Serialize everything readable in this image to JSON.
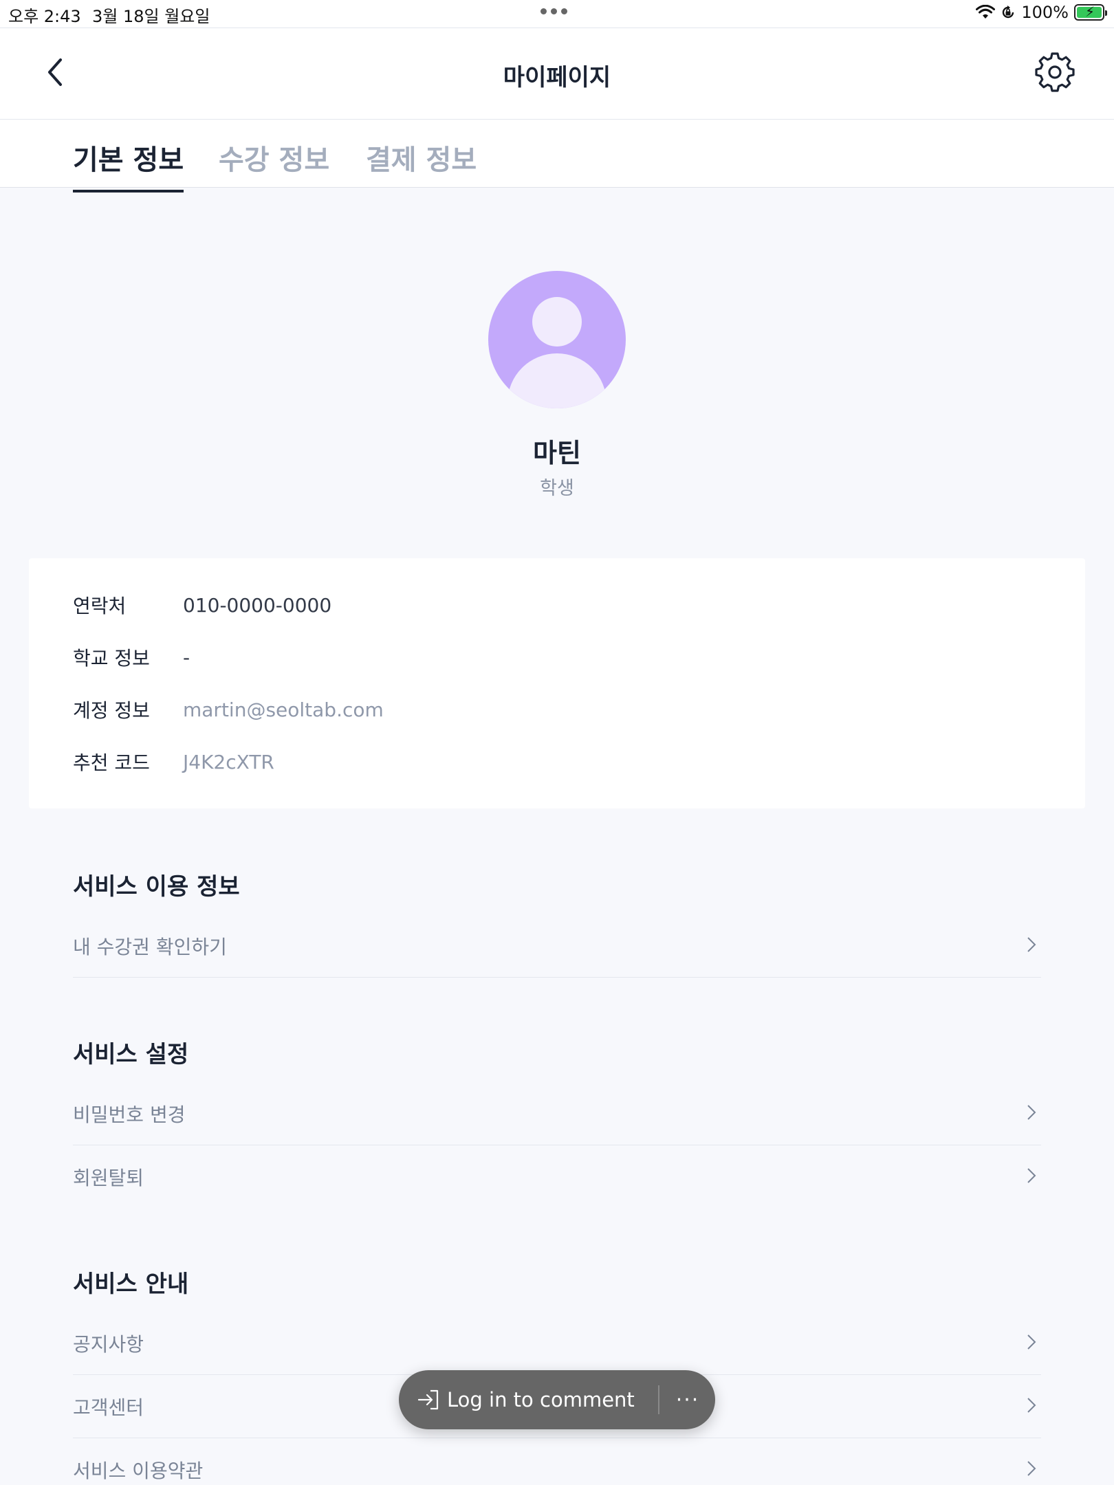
{
  "status_bar": {
    "time": "오후 2:43",
    "date": "3월 18일 월요일",
    "battery": "100%",
    "icons": [
      "wifi-icon",
      "orientation-lock-icon",
      "battery-charging-icon"
    ]
  },
  "header": {
    "title": "마이페이지",
    "back_icon": "chevron-left-icon",
    "settings_icon": "gear-icon"
  },
  "tabs": [
    {
      "label": "기본 정보",
      "active": true
    },
    {
      "label": "수강 정보",
      "active": false
    },
    {
      "label": "결제 정보",
      "active": false
    }
  ],
  "profile": {
    "name": "마틴",
    "role": "학생",
    "avatar_color": "#c3a9fb"
  },
  "info": {
    "contact": {
      "label": "연락처",
      "value": "010-0000-0000"
    },
    "school": {
      "label": "학교 정보",
      "value": "-"
    },
    "account": {
      "label": "계정 정보",
      "value": "martin@seoltab.com"
    },
    "referral": {
      "label": "추천 코드",
      "value": "J4K2cXTR"
    }
  },
  "sections": {
    "usage": {
      "title": "서비스 이용 정보",
      "items": [
        {
          "label": "내 수강권 확인하기"
        }
      ]
    },
    "settings": {
      "title": "서비스 설정",
      "items": [
        {
          "label": "비밀번호 변경"
        },
        {
          "label": "회원탈퇴"
        }
      ]
    },
    "guide": {
      "title": "서비스 안내",
      "items": [
        {
          "label": "공지사항"
        },
        {
          "label": "고객센터"
        },
        {
          "label": "서비스 이용약관"
        }
      ]
    }
  },
  "comment_bar": {
    "login_label": "Log in to comment",
    "more_label": "···"
  }
}
